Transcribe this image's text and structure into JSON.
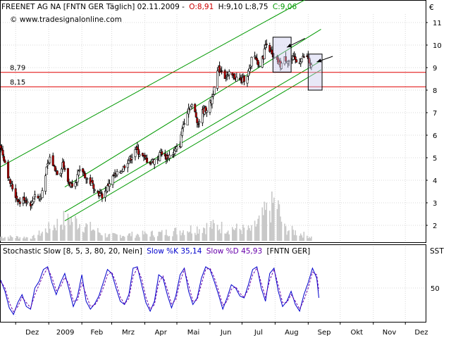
{
  "header": {
    "symbol": "FREENET AG NA [FNTN GER  Täglich] 02.11.2009 -",
    "open": "O:8,91",
    "hl": "H:9,10 L:8,75",
    "close": "C:9,06",
    "website": "© www.tradesignalonline.com",
    "currency": "€"
  },
  "stoch_header": {
    "title": "Stochastic Slow [8, 5, 3, 80, 20, Nein]",
    "k": "Slow %K 35,14",
    "d": "Slow %D 45,93",
    "sym": "[FNTN GER]",
    "label": "SST"
  },
  "hlines": [
    {
      "label": "8,79",
      "value": 8.79
    },
    {
      "label": "8,15",
      "value": 8.15
    }
  ],
  "colors": {
    "up": "#ffffff",
    "down": "#c00000",
    "wick": "#000000",
    "channel": "#009900",
    "hline": "#e00000",
    "volume": "#c8c8c8",
    "k": "#0000cc",
    "d": "#6600aa",
    "box_fill": "#ccccee",
    "box_stroke": "#000000"
  },
  "chart_data": [
    {
      "type": "candlestick",
      "title": "FREENET AG NA [FNTN GER  Täglich]",
      "ylabel": "€",
      "ylim": [
        1.4,
        11.5
      ],
      "y_ticks": [
        "2",
        "3",
        "4",
        "5",
        "6",
        "7",
        "8",
        "9",
        "10",
        "11"
      ],
      "x_ticks": [
        "Dez",
        "2009",
        "Feb",
        "Mrz",
        "Apr",
        "Mai",
        "Jun",
        "Jul",
        "Aug",
        "Sep",
        "Okt",
        "Nov",
        "Dez"
      ],
      "xlim_days": [
        0,
        398
      ],
      "ohlc_keyframes": [
        [
          0,
          5.5
        ],
        [
          4,
          4.8
        ],
        [
          8,
          4.0
        ],
        [
          14,
          3.3
        ],
        [
          18,
          3.0
        ],
        [
          22,
          3.2
        ],
        [
          26,
          3.0
        ],
        [
          29,
          2.95
        ],
        [
          32,
          3.4
        ],
        [
          35,
          3.2
        ],
        [
          38,
          3.3
        ],
        [
          42,
          4.3
        ],
        [
          46,
          5.0
        ],
        [
          50,
          4.6
        ],
        [
          55,
          4.2
        ],
        [
          58,
          4.8
        ],
        [
          62,
          4.0
        ],
        [
          66,
          3.8
        ],
        [
          70,
          4.0
        ],
        [
          73,
          4.3
        ],
        [
          76,
          4.5
        ],
        [
          80,
          4.1
        ],
        [
          84,
          3.9
        ],
        [
          88,
          3.7
        ],
        [
          92,
          3.4
        ],
        [
          95,
          3.3
        ],
        [
          98,
          3.5
        ],
        [
          102,
          3.9
        ],
        [
          106,
          4.2
        ],
        [
          110,
          4.3
        ],
        [
          114,
          4.5
        ],
        [
          118,
          4.8
        ],
        [
          122,
          5.0
        ],
        [
          126,
          5.4
        ],
        [
          128,
          5.3
        ],
        [
          132,
          5.1
        ],
        [
          136,
          4.9
        ],
        [
          140,
          4.8
        ],
        [
          144,
          4.9
        ],
        [
          148,
          5.0
        ],
        [
          150,
          5.3
        ],
        [
          154,
          5.0
        ],
        [
          158,
          5.1
        ],
        [
          162,
          5.2
        ],
        [
          165,
          5.4
        ],
        [
          168,
          5.6
        ],
        [
          170,
          6.3
        ],
        [
          173,
          6.8
        ],
        [
          176,
          7.2
        ],
        [
          179,
          7.3
        ],
        [
          182,
          7.0
        ],
        [
          185,
          6.5
        ],
        [
          188,
          7.0
        ],
        [
          191,
          7.1
        ],
        [
          194,
          7.2
        ],
        [
          197,
          7.5
        ],
        [
          199,
          7.9
        ],
        [
          201,
          8.6
        ],
        [
          204,
          8.9
        ],
        [
          207,
          8.9
        ],
        [
          210,
          8.6
        ],
        [
          214,
          8.7
        ],
        [
          218,
          8.6
        ],
        [
          222,
          8.5
        ],
        [
          226,
          8.4
        ],
        [
          230,
          8.6
        ],
        [
          234,
          9.0
        ],
        [
          236,
          9.8
        ],
        [
          238,
          9.5
        ],
        [
          240,
          9.3
        ],
        [
          243,
          9.1
        ],
        [
          246,
          9.5
        ],
        [
          248,
          10.0
        ],
        [
          250,
          10.3
        ],
        [
          252,
          9.8
        ],
        [
          255,
          9.4
        ],
        [
          258,
          9.3
        ],
        [
          262,
          9.1
        ],
        [
          266,
          9.4
        ],
        [
          270,
          9.3
        ],
        [
          274,
          9.4
        ],
        [
          278,
          9.2
        ],
        [
          282,
          9.4
        ],
        [
          285,
          9.5
        ],
        [
          288,
          9.4
        ],
        [
          290,
          9.0
        ],
        [
          292,
          9.06
        ]
      ]
    },
    {
      "type": "line",
      "title": "Stochastic Slow [8, 5, 3, 80, 20, Nein]",
      "ylim": [
        0,
        100
      ],
      "y_ticks": [
        "50"
      ],
      "series": [
        {
          "name": "Slow %K",
          "keyframes": [
            [
              0,
              62
            ],
            [
              4,
              45
            ],
            [
              8,
              20
            ],
            [
              12,
              10
            ],
            [
              16,
              28
            ],
            [
              20,
              40
            ],
            [
              24,
              22
            ],
            [
              28,
              18
            ],
            [
              32,
              50
            ],
            [
              36,
              60
            ],
            [
              40,
              78
            ],
            [
              44,
              82
            ],
            [
              48,
              58
            ],
            [
              52,
              40
            ],
            [
              56,
              58
            ],
            [
              60,
              72
            ],
            [
              64,
              48
            ],
            [
              68,
              22
            ],
            [
              72,
              38
            ],
            [
              76,
              70
            ],
            [
              80,
              30
            ],
            [
              84,
              18
            ],
            [
              88,
              26
            ],
            [
              92,
              38
            ],
            [
              96,
              58
            ],
            [
              100,
              78
            ],
            [
              104,
              72
            ],
            [
              108,
              50
            ],
            [
              112,
              30
            ],
            [
              116,
              25
            ],
            [
              120,
              40
            ],
            [
              124,
              80
            ],
            [
              128,
              82
            ],
            [
              132,
              55
            ],
            [
              136,
              28
            ],
            [
              140,
              15
            ],
            [
              144,
              30
            ],
            [
              148,
              70
            ],
            [
              152,
              65
            ],
            [
              156,
              40
            ],
            [
              160,
              20
            ],
            [
              164,
              38
            ],
            [
              168,
              70
            ],
            [
              172,
              80
            ],
            [
              176,
              45
            ],
            [
              180,
              25
            ],
            [
              184,
              35
            ],
            [
              188,
              65
            ],
            [
              192,
              82
            ],
            [
              196,
              78
            ],
            [
              200,
              60
            ],
            [
              204,
              40
            ],
            [
              208,
              18
            ],
            [
              212,
              35
            ],
            [
              216,
              55
            ],
            [
              220,
              50
            ],
            [
              224,
              38
            ],
            [
              228,
              35
            ],
            [
              232,
              55
            ],
            [
              236,
              78
            ],
            [
              240,
              82
            ],
            [
              244,
              50
            ],
            [
              248,
              30
            ],
            [
              252,
              72
            ],
            [
              256,
              80
            ],
            [
              260,
              45
            ],
            [
              264,
              22
            ],
            [
              268,
              30
            ],
            [
              272,
              45
            ],
            [
              276,
              25
            ],
            [
              280,
              15
            ],
            [
              284,
              40
            ],
            [
              288,
              58
            ],
            [
              292,
              80
            ],
            [
              296,
              65
            ],
            [
              298,
              35.14
            ]
          ]
        },
        {
          "name": "Slow %D",
          "keyframes": [
            [
              0,
              60
            ],
            [
              4,
              50
            ],
            [
              8,
              28
            ],
            [
              12,
              14
            ],
            [
              16,
              22
            ],
            [
              20,
              36
            ],
            [
              24,
              28
            ],
            [
              28,
              20
            ],
            [
              32,
              40
            ],
            [
              36,
              55
            ],
            [
              40,
              70
            ],
            [
              44,
              80
            ],
            [
              48,
              66
            ],
            [
              52,
              46
            ],
            [
              56,
              52
            ],
            [
              60,
              66
            ],
            [
              64,
              56
            ],
            [
              68,
              30
            ],
            [
              72,
              32
            ],
            [
              76,
              58
            ],
            [
              80,
              40
            ],
            [
              84,
              22
            ],
            [
              88,
              24
            ],
            [
              92,
              34
            ],
            [
              96,
              50
            ],
            [
              100,
              70
            ],
            [
              104,
              74
            ],
            [
              108,
              58
            ],
            [
              112,
              36
            ],
            [
              116,
              26
            ],
            [
              120,
              34
            ],
            [
              124,
              68
            ],
            [
              128,
              80
            ],
            [
              132,
              64
            ],
            [
              136,
              36
            ],
            [
              140,
              18
            ],
            [
              144,
              25
            ],
            [
              148,
              58
            ],
            [
              152,
              68
            ],
            [
              156,
              48
            ],
            [
              160,
              26
            ],
            [
              164,
              32
            ],
            [
              168,
              60
            ],
            [
              172,
              78
            ],
            [
              176,
              55
            ],
            [
              180,
              30
            ],
            [
              184,
              32
            ],
            [
              188,
              56
            ],
            [
              192,
              78
            ],
            [
              196,
              80
            ],
            [
              200,
              66
            ],
            [
              204,
              46
            ],
            [
              208,
              24
            ],
            [
              212,
              30
            ],
            [
              216,
              48
            ],
            [
              220,
              52
            ],
            [
              224,
              42
            ],
            [
              228,
              36
            ],
            [
              232,
              48
            ],
            [
              236,
              70
            ],
            [
              240,
              80
            ],
            [
              244,
              58
            ],
            [
              248,
              36
            ],
            [
              252,
              62
            ],
            [
              256,
              78
            ],
            [
              260,
              54
            ],
            [
              264,
              28
            ],
            [
              268,
              28
            ],
            [
              272,
              40
            ],
            [
              276,
              30
            ],
            [
              280,
              18
            ],
            [
              284,
              32
            ],
            [
              288,
              50
            ],
            [
              292,
              74
            ],
            [
              296,
              70
            ],
            [
              298,
              45.93
            ]
          ]
        }
      ]
    }
  ],
  "volume_keyframes": [
    [
      0,
      0.1
    ],
    [
      30,
      0.08
    ],
    [
      63,
      0.55
    ],
    [
      100,
      0.12
    ],
    [
      150,
      0.18
    ],
    [
      197,
      0.35
    ],
    [
      235,
      0.25
    ],
    [
      258,
      0.95
    ],
    [
      265,
      0.3
    ],
    [
      292,
      0.08
    ]
  ],
  "trendlines_data": [
    {
      "from": [
        0,
        4.6
      ],
      "to": [
        300,
        12.4
      ]
    },
    {
      "from": [
        60,
        3.7
      ],
      "to": [
        300,
        10.7
      ]
    },
    {
      "from": [
        60,
        2.6
      ],
      "to": [
        300,
        9.3
      ]
    },
    {
      "from": [
        60,
        2.2
      ],
      "to": [
        300,
        8.9
      ]
    }
  ],
  "boxes_data": [
    {
      "x": [
        255,
        272
      ],
      "y": [
        8.8,
        10.35
      ]
    },
    {
      "x": [
        288,
        301
      ],
      "y": [
        8.0,
        9.6
      ]
    }
  ],
  "arrows_data": [
    {
      "from": [
        285,
        10.3
      ],
      "to": [
        268,
        9.9
      ]
    },
    {
      "from": [
        311,
        9.5
      ],
      "to": [
        296,
        9.25
      ]
    }
  ]
}
